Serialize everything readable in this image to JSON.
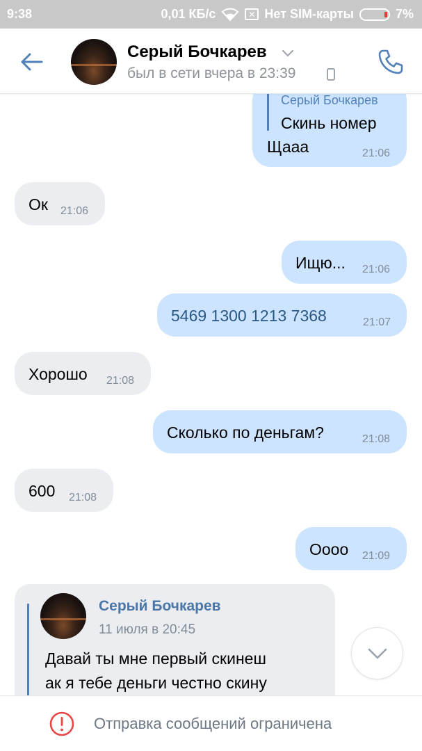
{
  "statusbar": {
    "time": "9:38",
    "speed": "0,01 КБ/с",
    "sim": "Нет SIM-карты",
    "battery": "7%",
    "battery_level": 0.07
  },
  "header": {
    "name": "Серый Бочкарев",
    "status": "был в сети вчера в 23:39",
    "back_icon": "arrow-left-icon",
    "call_icon": "phone-icon"
  },
  "messages": [
    {
      "dir": "out",
      "reply_to": "Серый Бочкарев",
      "reply_text": "Скинь номер",
      "text": "Щааа",
      "time": "21:06"
    },
    {
      "dir": "in",
      "text": "Ок",
      "time": "21:06"
    },
    {
      "dir": "out",
      "text": "Ищю...",
      "time": "21:06"
    },
    {
      "dir": "out",
      "text": "5469 1300 1213 7368",
      "time": "21:07"
    },
    {
      "dir": "in",
      "text": "Хорошо",
      "time": "21:08"
    },
    {
      "dir": "out",
      "text": "Сколько по деньгам?",
      "time": "21:08"
    },
    {
      "dir": "in",
      "text": "600",
      "time": "21:08"
    },
    {
      "dir": "out",
      "text": "Оооо",
      "time": "21:09"
    }
  ],
  "forwarded": {
    "author": "Серый Бочкарев",
    "date": "11 июля в 20:45",
    "line1": "Давай ты мне первый скинеш",
    "line2": "ак я тебе деньги честно скину"
  },
  "bottom": {
    "text": "Отправка сообщений ограничена"
  },
  "colors": {
    "accent": "#5181b8",
    "bubble_out": "#cce4ff",
    "bubble_in": "#ebedf0",
    "warning": "#e64646"
  }
}
